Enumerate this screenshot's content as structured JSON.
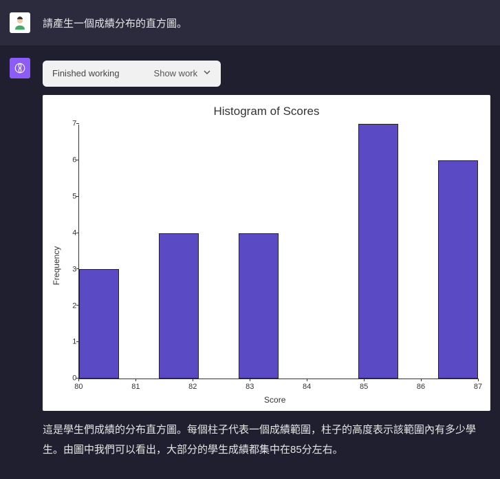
{
  "user": {
    "prompt": "請產生一個成績分布的直方圖。"
  },
  "assistant": {
    "work_pill": {
      "status": "Finished working",
      "toggle": "Show work"
    },
    "caption": "這是學生們成績的分布直方圖。每個柱子代表一個成績範圍，柱子的高度表示該範圍內有多少學生。由圖中我們可以看出，大部分的學生成績都集中在85分左右。"
  },
  "chart_data": {
    "type": "bar",
    "title": "Histogram of Scores",
    "xlabel": "Score",
    "ylabel": "Frequency",
    "xlim": [
      80,
      87
    ],
    "ylim": [
      0,
      7
    ],
    "yticks": [
      0,
      1,
      2,
      3,
      4,
      5,
      6,
      7
    ],
    "xticks": [
      80,
      81,
      82,
      83,
      84,
      85,
      86,
      87
    ],
    "bins": [
      {
        "start": 80.0,
        "end": 80.7,
        "count": 3
      },
      {
        "start": 81.4,
        "end": 82.1,
        "count": 4
      },
      {
        "start": 82.1,
        "end": 82.8,
        "count": 0
      },
      {
        "start": 82.8,
        "end": 83.5,
        "count": 4
      },
      {
        "start": 84.9,
        "end": 85.6,
        "count": 7
      },
      {
        "start": 85.6,
        "end": 86.3,
        "count": 0
      },
      {
        "start": 86.3,
        "end": 87.0,
        "count": 6
      }
    ],
    "color": "#5a4bc4"
  }
}
